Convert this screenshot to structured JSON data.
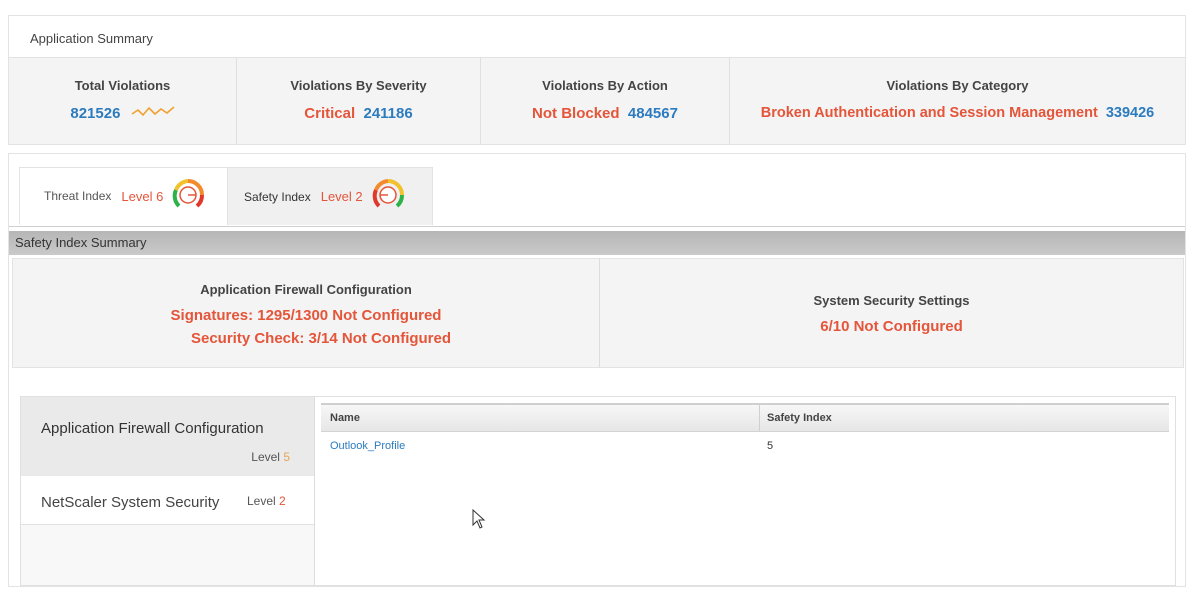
{
  "app_summary": {
    "title": "Application Summary",
    "total_violations": {
      "label": "Total Violations",
      "value": "821526",
      "sparkline_icon": "sparkline-icon"
    },
    "by_severity": {
      "label": "Violations By Severity",
      "name": "Critical",
      "value": "241186"
    },
    "by_action": {
      "label": "Violations By Action",
      "name": "Not Blocked",
      "value": "484567"
    },
    "by_category": {
      "label": "Violations By Category",
      "name": "Broken Authentication and Session Management",
      "value": "339426"
    }
  },
  "tabs": [
    {
      "label": "Threat Index",
      "level": "Level 6",
      "icon": "gauge-icon"
    },
    {
      "label": "Safety Index",
      "level": "Level 2",
      "icon": "gauge-icon"
    }
  ],
  "safety_summary": {
    "title": "Safety Index Summary",
    "firewall": {
      "heading": "Application Firewall Configuration",
      "signatures": "Signatures: 1295/1300 Not Configured",
      "security_check": "Security Check: 3/14 Not Configured"
    },
    "system": {
      "heading": "System Security Settings",
      "status": "6/10 Not Configured"
    }
  },
  "detail": {
    "list": [
      {
        "name": "Application Firewall Configuration",
        "level_word": "Level",
        "level_num": "5"
      },
      {
        "name": "NetScaler System Security",
        "level_word": "Level",
        "level_num": "2"
      }
    ],
    "table": {
      "columns": [
        "Name",
        "Safety Index"
      ],
      "rows": [
        {
          "name": "Outlook_Profile",
          "safety_index": "5"
        }
      ]
    }
  },
  "colors": {
    "accent_red": "#e4553a",
    "accent_blue": "#2c7bbf",
    "level_yellow": "#e8a35a"
  }
}
